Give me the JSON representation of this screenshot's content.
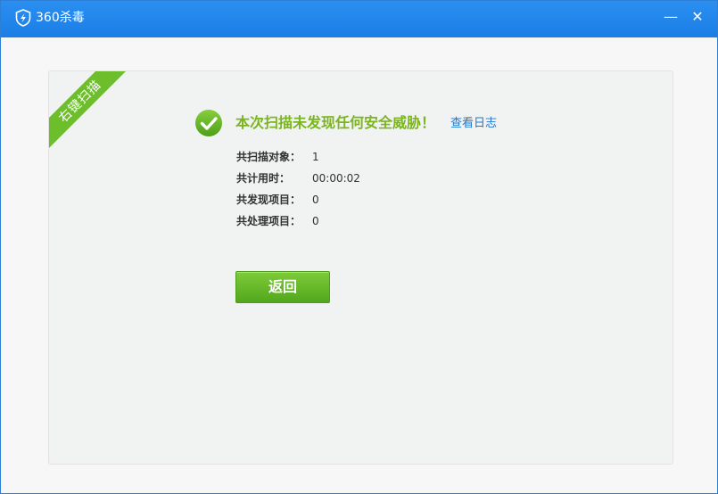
{
  "window": {
    "title": "360杀毒",
    "minimize_glyph": "—",
    "close_glyph": "✕",
    "icons": [
      "shield-logo-icon",
      "minimize-icon",
      "close-icon",
      "check-circle-icon"
    ],
    "accent_color": "#1a7ee6",
    "success_color": "#7ab51d"
  },
  "ribbon": {
    "label": "右键扫描"
  },
  "result": {
    "headline": "本次扫描未发现任何安全威胁！",
    "log_link": "查看日志"
  },
  "stats": [
    {
      "label": "共扫描对象：",
      "value": "1"
    },
    {
      "label": "共计用时：",
      "value": "00:00:02"
    },
    {
      "label": "共发现项目：",
      "value": "0"
    },
    {
      "label": "共处理项目：",
      "value": "0"
    }
  ],
  "actions": {
    "back_label": "返回"
  }
}
